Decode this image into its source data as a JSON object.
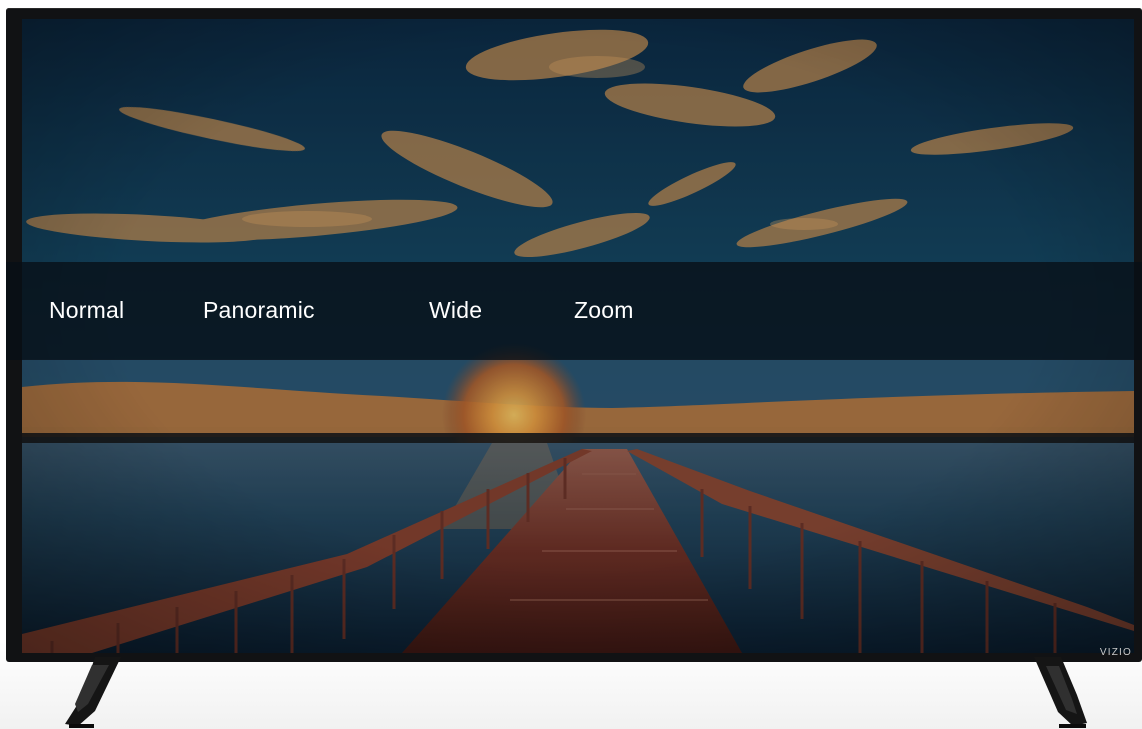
{
  "aspect_menu": {
    "items": [
      {
        "label": "Normal"
      },
      {
        "label": "Panoramic"
      },
      {
        "label": "Wide"
      },
      {
        "label": "Zoom"
      }
    ]
  },
  "tv": {
    "brand": "VIZIO"
  },
  "colors": {
    "bezel": "#111214",
    "menu_overlay": "#080e16",
    "menu_text": "#ffffff",
    "sky": "#18435c",
    "sunset": "#e59a3b",
    "pier": "#7b3e2d"
  }
}
